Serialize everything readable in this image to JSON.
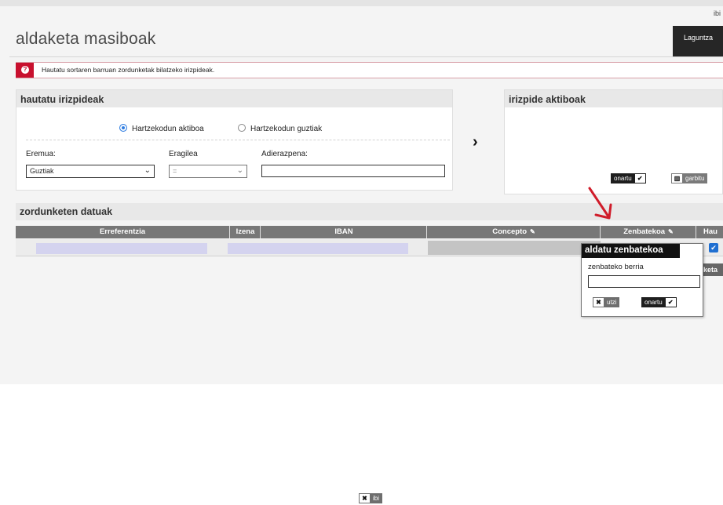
{
  "top_link": "ibi",
  "page_title": "aldaketa masiboak",
  "help_button": "Laguntza",
  "alert": {
    "icon": "exclamation-icon",
    "text": "Hautatu sortaren barruan zordunketak bilatzeko irizpideak."
  },
  "criteria_panel": {
    "title": "hautatu irizpideak",
    "radio_active": "Hartzekodun aktiboa",
    "radio_all": "Hartzekodun guztiak",
    "selected_radio": "Hartzekodun aktiboa",
    "scope_label": "Eremua:",
    "scope_value": "Guztiak",
    "operator_label": "Eragilea",
    "operator_value": "=",
    "expression_label": "Adierazpena:",
    "expression_value": ""
  },
  "active_panel": {
    "title": "irizpide aktiboak",
    "accept_label": "onartu",
    "clear_label": "garbitu"
  },
  "data_section": {
    "title": "zordunketen datuak",
    "columns": [
      "Erreferentzia",
      "Izena",
      "IBAN",
      "Concepto",
      "Zenbatekoa",
      "Hau"
    ],
    "row_checked": true,
    "hidden_tab_label": "keta"
  },
  "edit_popup": {
    "title": "aldatu zenbatekoa",
    "field_label": "zenbateko berria",
    "field_value": "",
    "cancel_label": "utzi",
    "accept_label": "onartu"
  },
  "bottom_button": "ibi",
  "colors": {
    "accent_red": "#c8102e",
    "header_grey": "#777777",
    "dark": "#1e1e1e",
    "checkbox_blue": "#1f6fd1"
  }
}
